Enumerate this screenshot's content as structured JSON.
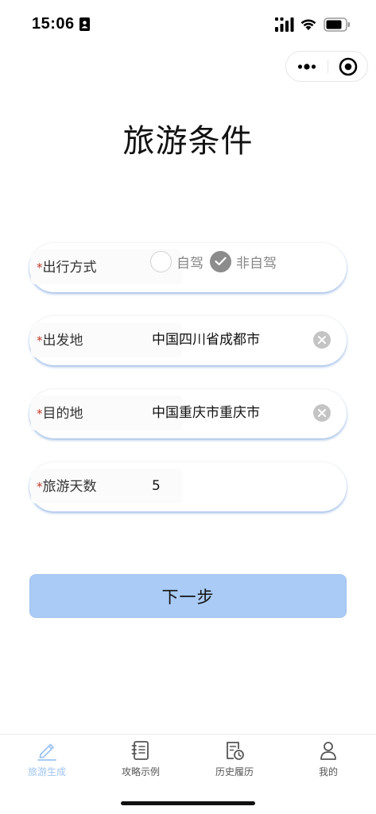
{
  "status_bar": {
    "time": "15:06"
  },
  "capsule": {
    "more_icon": "more-dots-icon",
    "close_icon": "target-circle-icon"
  },
  "page": {
    "title": "旅游条件"
  },
  "form": {
    "required_mark": "*",
    "travel_mode": {
      "label": "出行方式",
      "options": [
        {
          "label": "自驾",
          "checked": false
        },
        {
          "label": "非自驾",
          "checked": true
        }
      ]
    },
    "departure": {
      "label": "出发地",
      "value": "中国四川省成都市"
    },
    "destination": {
      "label": "目的地",
      "value": "中国重庆市重庆市"
    },
    "days": {
      "label": "旅游天数",
      "value": "5"
    }
  },
  "next_button": {
    "label": "下一步"
  },
  "tab_bar": {
    "active_color": "#9ec4f2",
    "tabs": [
      {
        "label": "旅游生成",
        "icon": "pencil-icon",
        "active": true
      },
      {
        "label": "攻略示例",
        "icon": "notebook-icon",
        "active": false
      },
      {
        "label": "历史履历",
        "icon": "history-document-icon",
        "active": false
      },
      {
        "label": "我的",
        "icon": "user-icon",
        "active": false
      }
    ]
  },
  "colors": {
    "primary_button": "#a9cbf6",
    "required": "#c0392b",
    "radio_checked": "#8c8c8c"
  }
}
